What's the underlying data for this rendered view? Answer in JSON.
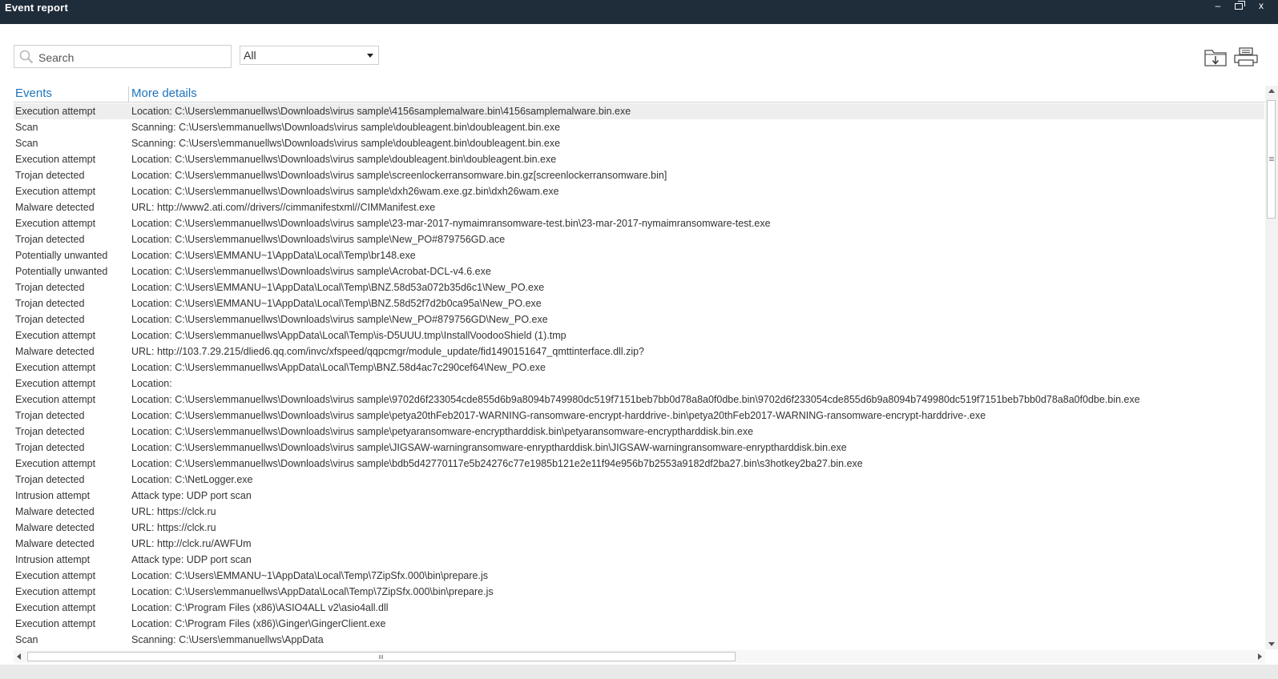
{
  "window": {
    "title": "Event report",
    "minimize_label": "–",
    "close_label": "x"
  },
  "toolbar": {
    "search_placeholder": "Search",
    "filter_value": "All"
  },
  "table": {
    "columns": [
      "Events",
      "More details"
    ],
    "rows": [
      {
        "event": "Execution attempt",
        "details": "Location: C:\\Users\\emmanuellws\\Downloads\\virus sample\\4156samplemalware.bin\\4156samplemalware.bin.exe"
      },
      {
        "event": "Scan",
        "details": "Scanning: C:\\Users\\emmanuellws\\Downloads\\virus sample\\doubleagent.bin\\doubleagent.bin.exe"
      },
      {
        "event": "Scan",
        "details": "Scanning: C:\\Users\\emmanuellws\\Downloads\\virus sample\\doubleagent.bin\\doubleagent.bin.exe"
      },
      {
        "event": "Execution attempt",
        "details": "Location: C:\\Users\\emmanuellws\\Downloads\\virus sample\\doubleagent.bin\\doubleagent.bin.exe"
      },
      {
        "event": "Trojan detected",
        "details": "Location: C:\\Users\\emmanuellws\\Downloads\\virus sample\\screenlockerransomware.bin.gz[screenlockerransomware.bin]"
      },
      {
        "event": "Execution attempt",
        "details": "Location: C:\\Users\\emmanuellws\\Downloads\\virus sample\\dxh26wam.exe.gz.bin\\dxh26wam.exe"
      },
      {
        "event": "Malware detected",
        "details": "URL: http://www2.ati.com//drivers//cimmanifestxml//CIMManifest.exe"
      },
      {
        "event": "Execution attempt",
        "details": "Location: C:\\Users\\emmanuellws\\Downloads\\virus sample\\23-mar-2017-nymaimransomware-test.bin\\23-mar-2017-nymaimransomware-test.exe"
      },
      {
        "event": "Trojan detected",
        "details": "Location: C:\\Users\\emmanuellws\\Downloads\\virus sample\\New_PO#879756GD.ace"
      },
      {
        "event": "Potentially unwanted",
        "details": "Location: C:\\Users\\EMMANU~1\\AppData\\Local\\Temp\\br148.exe"
      },
      {
        "event": "Potentially unwanted",
        "details": "Location: C:\\Users\\emmanuellws\\Downloads\\virus sample\\Acrobat-DCL-v4.6.exe"
      },
      {
        "event": "Trojan detected",
        "details": "Location: C:\\Users\\EMMANU~1\\AppData\\Local\\Temp\\BNZ.58d53a072b35d6c1\\New_PO.exe"
      },
      {
        "event": "Trojan detected",
        "details": "Location: C:\\Users\\EMMANU~1\\AppData\\Local\\Temp\\BNZ.58d52f7d2b0ca95a\\New_PO.exe"
      },
      {
        "event": "Trojan detected",
        "details": "Location: C:\\Users\\emmanuellws\\Downloads\\virus sample\\New_PO#879756GD\\New_PO.exe"
      },
      {
        "event": "Execution attempt",
        "details": "Location: C:\\Users\\emmanuellws\\AppData\\Local\\Temp\\is-D5UUU.tmp\\InstallVoodooShield (1).tmp"
      },
      {
        "event": "Malware detected",
        "details": "URL: http://103.7.29.215/dlied6.qq.com/invc/xfspeed/qqpcmgr/module_update/fid1490151647_qmttinterface.dll.zip?"
      },
      {
        "event": "Execution attempt",
        "details": "Location: C:\\Users\\emmanuellws\\AppData\\Local\\Temp\\BNZ.58d4ac7c290cef64\\New_PO.exe"
      },
      {
        "event": "Execution attempt",
        "details": "Location:"
      },
      {
        "event": "Execution attempt",
        "details": "Location: C:\\Users\\emmanuellws\\Downloads\\virus sample\\9702d6f233054cde855d6b9a8094b749980dc519f7151beb7bb0d78a8a0f0dbe.bin\\9702d6f233054cde855d6b9a8094b749980dc519f7151beb7bb0d78a8a0f0dbe.bin.exe"
      },
      {
        "event": "Trojan detected",
        "details": "Location: C:\\Users\\emmanuellws\\Downloads\\virus sample\\petya20thFeb2017-WARNING-ransomware-encrypt-harddrive-.bin\\petya20thFeb2017-WARNING-ransomware-encrypt-harddrive-.exe"
      },
      {
        "event": "Trojan detected",
        "details": "Location: C:\\Users\\emmanuellws\\Downloads\\virus sample\\petyaransomware-encryptharddisk.bin\\petyaransomware-encryptharddisk.bin.exe"
      },
      {
        "event": "Trojan detected",
        "details": "Location: C:\\Users\\emmanuellws\\Downloads\\virus sample\\JIGSAW-warningransomware-enryptharddisk.bin\\JIGSAW-warningransomware-enryptharddisk.bin.exe"
      },
      {
        "event": "Execution attempt",
        "details": "Location: C:\\Users\\emmanuellws\\Downloads\\virus sample\\bdb5d42770117e5b24276c77e1985b121e2e11f94e956b7b2553a9182df2ba27.bin\\s3hotkey2ba27.bin.exe"
      },
      {
        "event": "Trojan detected",
        "details": "Location: C:\\NetLogger.exe"
      },
      {
        "event": "Intrusion attempt",
        "details": "Attack type: UDP port scan"
      },
      {
        "event": "Malware detected",
        "details": "URL: https://clck.ru"
      },
      {
        "event": "Malware detected",
        "details": "URL: https://clck.ru"
      },
      {
        "event": "Malware detected",
        "details": "URL: http://clck.ru/AWFUm"
      },
      {
        "event": "Intrusion attempt",
        "details": "Attack type: UDP port scan"
      },
      {
        "event": "Execution attempt",
        "details": "Location: C:\\Users\\EMMANU~1\\AppData\\Local\\Temp\\7ZipSfx.000\\bin\\prepare.js"
      },
      {
        "event": "Execution attempt",
        "details": "Location: C:\\Users\\emmanuellws\\AppData\\Local\\Temp\\7ZipSfx.000\\bin\\prepare.js"
      },
      {
        "event": "Execution attempt",
        "details": "Location: C:\\Program Files (x86)\\ASIO4ALL v2\\asio4all.dll"
      },
      {
        "event": "Execution attempt",
        "details": "Location: C:\\Program Files (x86)\\Ginger\\GingerClient.exe"
      },
      {
        "event": "Scan",
        "details": "Scanning: C:\\Users\\emmanuellws\\AppData"
      }
    ]
  },
  "colors": {
    "titlebar": "#1f2c3a",
    "header_text": "#1e73be",
    "selected_row": "#eeeeee"
  },
  "icons": {
    "search": "search-icon",
    "export": "export-folder-icon",
    "print": "printer-icon",
    "dropdown": "chevron-down-icon"
  }
}
